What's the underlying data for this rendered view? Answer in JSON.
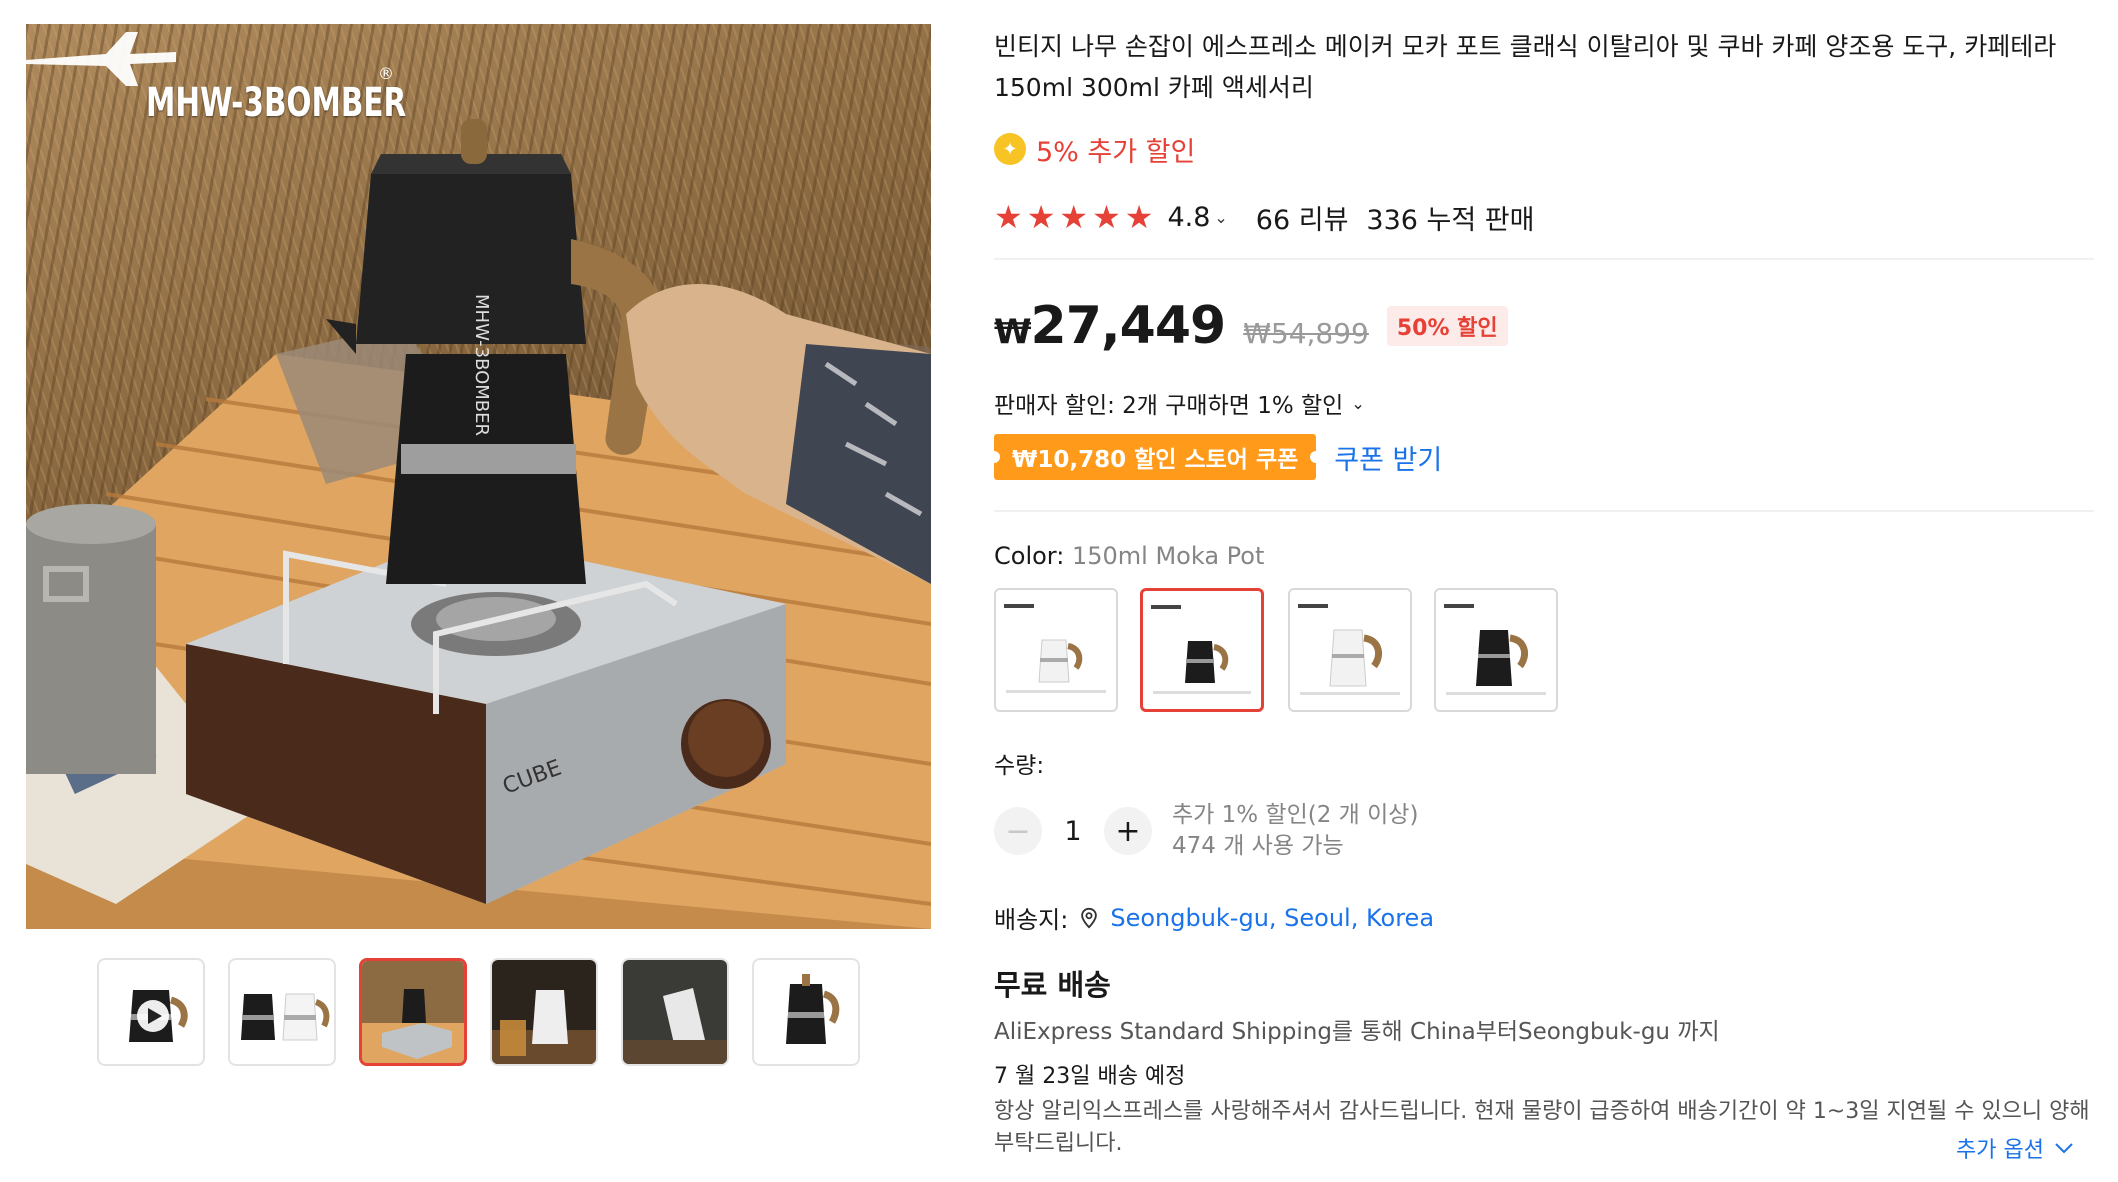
{
  "brand": {
    "logo_text": "MHW-3BOMBER",
    "reg_mark": "®"
  },
  "product": {
    "title": "빈티지 나무 손잡이 에스프레소 메이커 모카 포트 클래식 이탈리아 및 쿠바 카페 양조용 도구, 카페테라 150ml 300ml 카페 액세서리",
    "extra_discount": "5% 추가 할인",
    "rating": "4.8",
    "reviews": "66 리뷰",
    "sold": "336 누적 판매",
    "price_currency": "₩",
    "price_now": "27,449",
    "price_old": "₩54,899",
    "discount_badge": "50% 할인",
    "seller_discount": "판매자 할인: 2개 구매하면 1% 할인",
    "coupon_tag": "₩10,780 할인 스토어 쿠폰",
    "coupon_link": "쿠폰 받기",
    "color_label": "Color:",
    "color_value": "150ml Moka Pot",
    "swatches": [
      "white-150ml",
      "black-150ml",
      "white-300ml",
      "black-300ml"
    ],
    "selected_swatch": 1,
    "qty_label": "수량:",
    "qty_value": "1",
    "qty_note_1": "추가 1% 할인(2 개 이상)",
    "qty_note_2": "474 개 사용 가능",
    "ship_label": "배송지:",
    "ship_location": "Seongbuk-gu, Seoul, Korea",
    "free_shipping": "무료 배송",
    "ship_via": "AliExpress Standard Shipping를 통해 China부터Seongbuk-gu 까지",
    "eta": "7 월 23일 배송 예정",
    "notice": "항상 알리익스프레스를 사랑해주셔서 감사드립니다. 현재 물량이 급증하여 배송기간이 약 1~3일 지연될 수 있으니 양해 부탁드립니다.",
    "more_options": "추가 옵션"
  },
  "thumbnails": {
    "count": 6,
    "active_index": 2
  },
  "colors": {
    "accent": "#e64136",
    "link": "#1a73e8",
    "coupon": "#ff9a1a",
    "star": "#e64136"
  }
}
